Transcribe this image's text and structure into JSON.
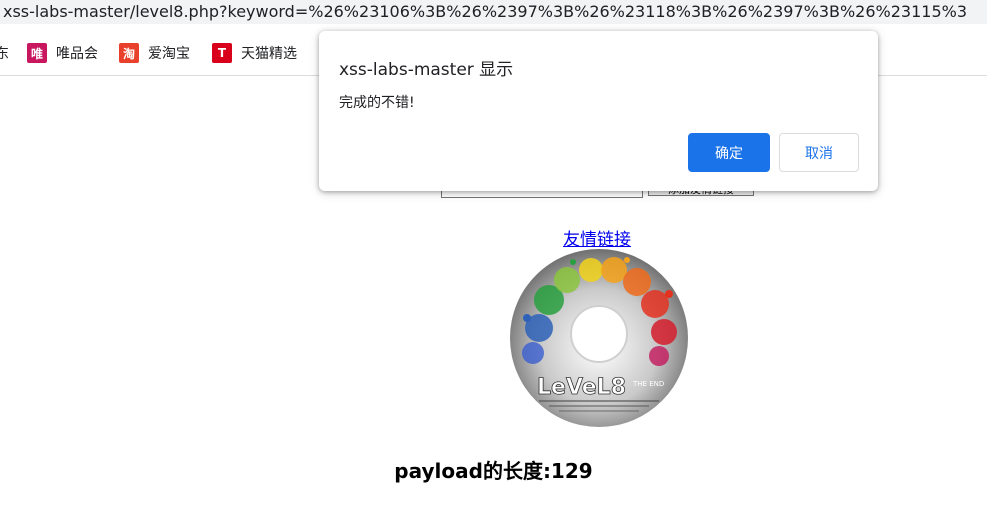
{
  "browser": {
    "url": "xss-labs-master/level8.php?keyword=%26%23106%3B%26%2397%3B%26%23118%3B%26%2397%3B%26%23115%3"
  },
  "bookmarks": [
    {
      "label": "东",
      "icon": "",
      "color": ""
    },
    {
      "label": "唯品会",
      "icon": "唯",
      "color": "#c8175f"
    },
    {
      "label": "爱淘宝",
      "icon": "淘",
      "color": "#e8402a"
    },
    {
      "label": "天猫精选",
      "icon": "T",
      "color": "#d9001b"
    }
  ],
  "page": {
    "search_value": "",
    "submit_label": "添加友情链接",
    "friend_link": "友情链接",
    "payload_label": "payload的长度:129"
  },
  "dialog": {
    "title": "xss-labs-master 显示",
    "message": "完成的不错!",
    "ok_label": "确定",
    "cancel_label": "取消"
  },
  "colors": {
    "accent": "#1a73e8",
    "link": "#0000ee"
  },
  "logo": {
    "text": "LeVeL8",
    "sub": "THE END"
  }
}
